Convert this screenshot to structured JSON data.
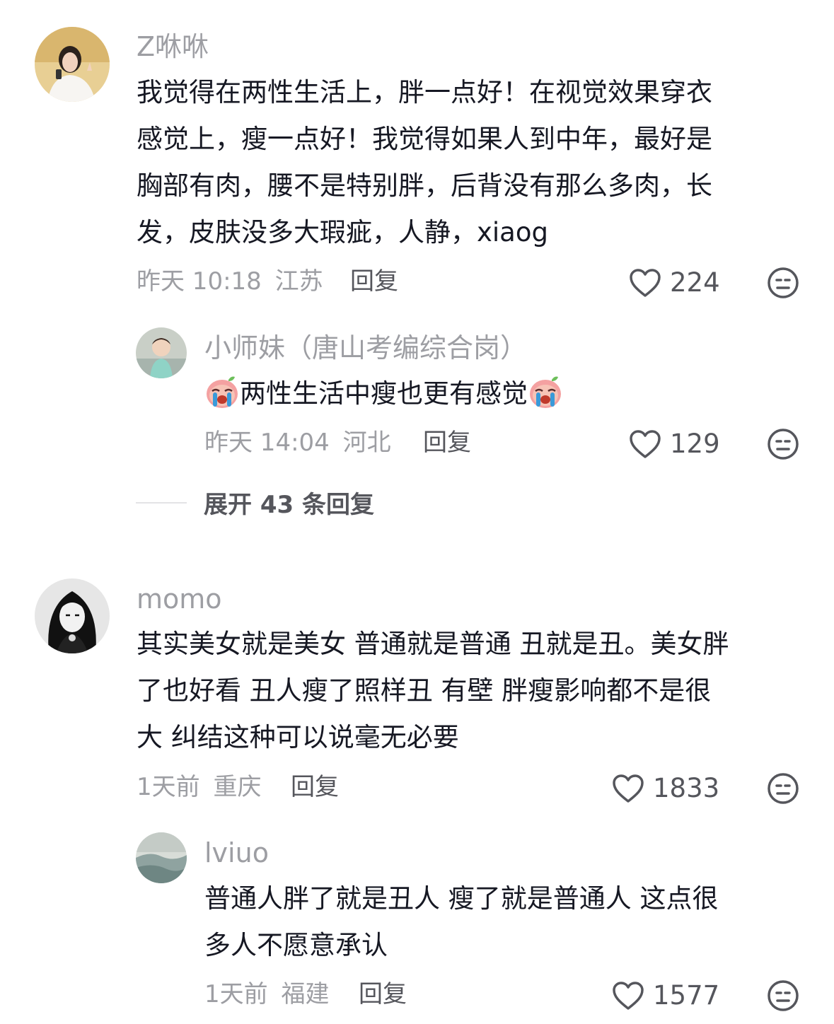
{
  "comments": [
    {
      "username": "Z咻咻",
      "text_lines": [
        "我觉得在两性生活上，胖一点好！在视觉效果穿衣",
        "感觉上，瘦一点好！我觉得如果人到中年，最好是",
        "胸部有肉，腰不是特别胖，后背没有那么多肉，长",
        "发，皮肤没多大瑕疵，人静，xiaog"
      ],
      "time": "昨天 10:18",
      "location": "江苏",
      "reply_label": "回复",
      "likes": "224",
      "replies": [
        {
          "username": "小师妹（唐山考编综合岗）",
          "text": "两性生活中瘦也更有感觉",
          "emoji": "crying-face",
          "time": "昨天 14:04",
          "location": "河北",
          "reply_label": "回复",
          "likes": "129"
        }
      ],
      "expand_label": "展开 43 条回复"
    },
    {
      "username": "momo",
      "text_lines": [
        "其实美女就是美女 普通就是普通 丑就是丑。美女胖",
        "了也好看 丑人瘦了照样丑 有壁 胖瘦影响都不是很",
        "大 纠结这种可以说毫无必要"
      ],
      "time": "1天前",
      "location": "重庆",
      "reply_label": "回复",
      "likes": "1833",
      "replies": [
        {
          "username": "lviuo",
          "text_lines": [
            "普通人胖了就是丑人 瘦了就是普通人 这点很",
            "多人不愿意承认"
          ],
          "time": "1天前",
          "location": "福建",
          "reply_label": "回复",
          "likes": "1577"
        }
      ]
    }
  ],
  "icons": {
    "like": "heart-outline-icon",
    "dislike": "meh-face-icon"
  },
  "colors": {
    "text": "#161823",
    "secondary": "#9d9ea3",
    "action": "#55565c"
  }
}
